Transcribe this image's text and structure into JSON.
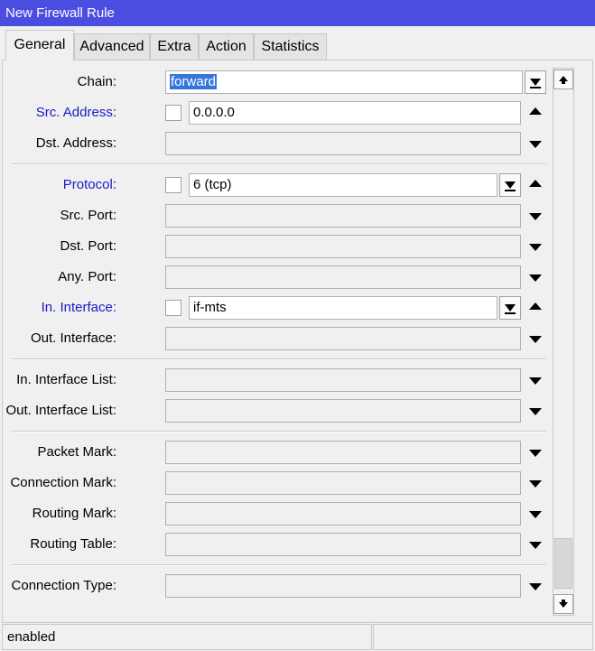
{
  "window": {
    "title": "New Firewall Rule"
  },
  "tabs": [
    {
      "label": "General",
      "active": true
    },
    {
      "label": "Advanced"
    },
    {
      "label": "Extra"
    },
    {
      "label": "Action"
    },
    {
      "label": "Statistics"
    }
  ],
  "fields": {
    "chain": {
      "label": "Chain:",
      "value": "forward"
    },
    "src_address": {
      "label": "Src. Address:",
      "value": "0.0.0.0"
    },
    "dst_address": {
      "label": "Dst. Address:",
      "value": ""
    },
    "protocol": {
      "label": "Protocol:",
      "value": "6 (tcp)"
    },
    "src_port": {
      "label": "Src. Port:",
      "value": ""
    },
    "dst_port": {
      "label": "Dst. Port:",
      "value": ""
    },
    "any_port": {
      "label": "Any. Port:",
      "value": ""
    },
    "in_interface": {
      "label": "In. Interface:",
      "value": "if-mts"
    },
    "out_interface": {
      "label": "Out. Interface:",
      "value": ""
    },
    "in_interface_list": {
      "label": "In. Interface List:",
      "value": ""
    },
    "out_interface_list": {
      "label": "Out. Interface List:",
      "value": ""
    },
    "packet_mark": {
      "label": "Packet Mark:",
      "value": ""
    },
    "connection_mark": {
      "label": "Connection Mark:",
      "value": ""
    },
    "routing_mark": {
      "label": "Routing Mark:",
      "value": ""
    },
    "routing_table": {
      "label": "Routing Table:",
      "value": ""
    },
    "connection_type": {
      "label": "Connection Type:",
      "value": ""
    }
  },
  "status": {
    "text": "enabled"
  },
  "colors": {
    "titlebar": "#4a4de0",
    "link_label": "#1a1ac8",
    "selection": "#3377dd"
  }
}
